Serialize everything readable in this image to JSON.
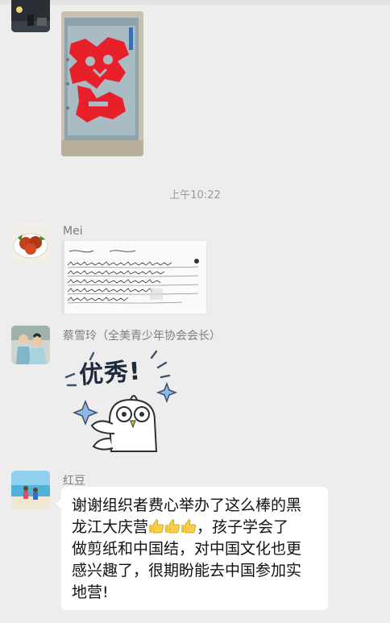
{
  "chat": {
    "timestamp": "上午10:22",
    "messages": [
      {
        "sender": "",
        "type": "image",
        "content": "paper-cut artwork photo"
      },
      {
        "sender": "Mei",
        "type": "image",
        "content": "handwritten note photo"
      },
      {
        "sender": "蔡雪玲（全美青少年协会会长）",
        "type": "sticker",
        "content": "优秀!"
      },
      {
        "sender": "红豆",
        "type": "text",
        "text_line1": "谢谢组织者费心举办了这么棒的黑",
        "text_line2a": "龙江大庆营",
        "text_line2b": "，孩子学会了",
        "text_line3": "做剪纸和中国结，对中国文化也更",
        "text_line4": "感兴趣了，很期盼能去中国参加实",
        "text_line5": "地营!"
      }
    ]
  },
  "sticker_text": "优秀!",
  "emoji": [
    "thumbs-up-icon",
    "thumbs-up-icon",
    "thumbs-up-icon"
  ],
  "colors": {
    "background": "#ededed",
    "bubble": "#ffffff",
    "papercut_red": "#e8202a",
    "name_gray": "#7d7d7d"
  }
}
